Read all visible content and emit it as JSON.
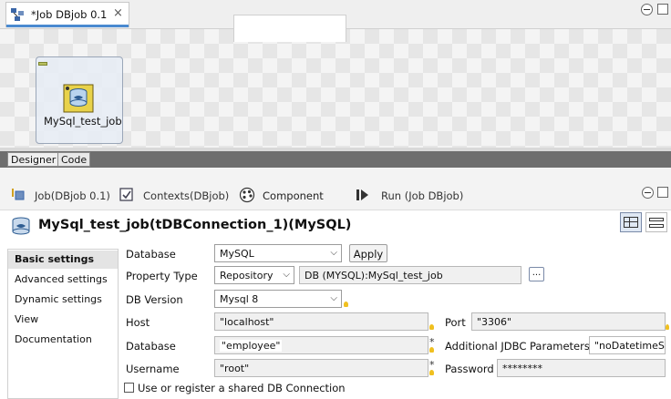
{
  "editor_tab": {
    "title": "*Job DBjob 0.1",
    "close_glyph": "×"
  },
  "component": {
    "label": "MySql_test_job"
  },
  "subtabs": {
    "designer": "Designer",
    "code": "Code"
  },
  "view_tabs": [
    {
      "label": "Job(DBjob 0.1)",
      "icon": "job-icon"
    },
    {
      "label": "Contexts(DBjob)",
      "icon": "contexts-icon"
    },
    {
      "label": "Component",
      "icon": "component-icon"
    },
    {
      "label": "Run (Job DBjob)",
      "icon": "run-icon"
    }
  ],
  "panel_title": "MySql_test_job(tDBConnection_1)(MySQL)",
  "nav": [
    "Basic settings",
    "Advanced settings",
    "Dynamic settings",
    "View",
    "Documentation"
  ],
  "form": {
    "database_type_label": "Database",
    "database_type_value": "MySQL",
    "apply_label": "Apply",
    "property_type_label": "Property Type",
    "property_type_value": "Repository",
    "repository_value": "DB (MYSQL):MySql_test_job",
    "browse_label": "...",
    "db_version_label": "DB Version",
    "db_version_value": "Mysql 8",
    "host_label": "Host",
    "host_value": "\"localhost\"",
    "port_label": "Port",
    "port_value": "\"3306\"",
    "database_label": "Database",
    "database_value": "\"employee\"",
    "jdbc_label": "Additional JDBC Parameters",
    "jdbc_value": "\"noDatetimeSt",
    "username_label": "Username",
    "username_value": "\"root\"",
    "password_label": "Password",
    "password_value": "********",
    "shared_conn_label": "Use or register a shared DB Connection",
    "required_mark": "*"
  },
  "colors": {
    "accent": "#4a8ad0",
    "selected_nav": "#e4e4e4",
    "subtab_bar": "#6e6e6e"
  }
}
